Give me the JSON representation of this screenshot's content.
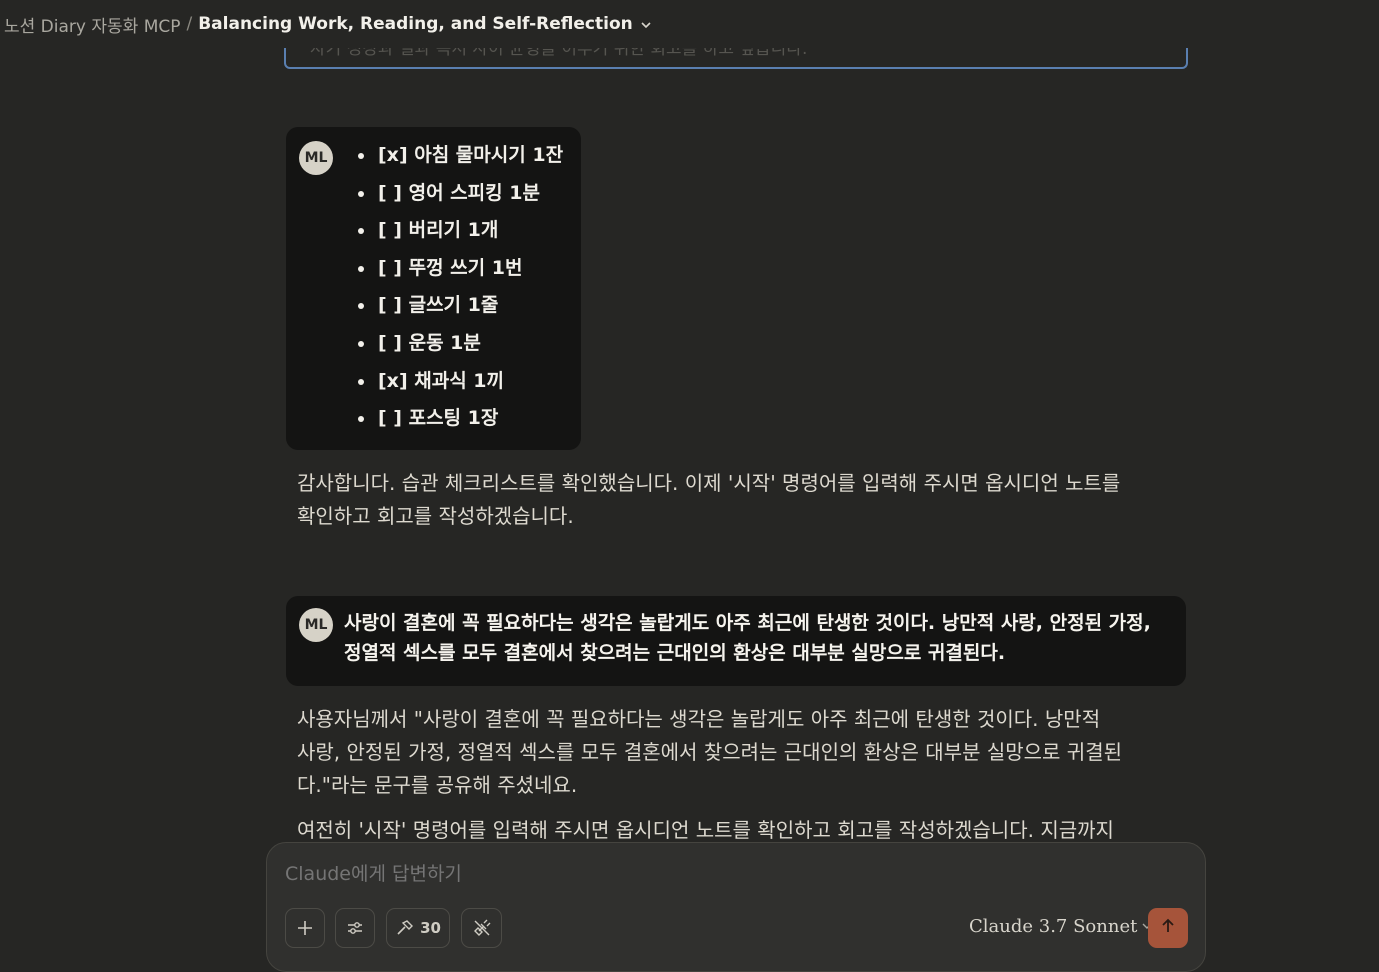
{
  "header": {
    "project": "노션 Diary 자동화 MCP",
    "separator": "/",
    "title": "Balancing Work, Reading, and Self-Reflection"
  },
  "previous_input_fragment": "자기 성장과 일과 독서 사이 균형을 이루기 위한 회고를 하고 싶습니다.",
  "messages": {
    "checklist_message": {
      "avatar": "ML",
      "items": [
        "[x] 아침 물마시기 1잔",
        "[ ] 영어 스피킹 1분",
        "[ ] 버리기 1개",
        "[ ] 뚜껑 쓰기 1번",
        "[ ] 글쓰기 1줄",
        "[ ] 운동 1분",
        "[x] 채과식 1끼",
        "[ ] 포스팅 1장"
      ]
    },
    "reply_1": {
      "line1": "감사합니다. 습관 체크리스트를 확인했습니다. 이제 '시작' 명령어를 입력해 주시면 옵시디언 노트를",
      "line2": "확인하고 회고를 작성하겠습니다."
    },
    "quote_message": {
      "avatar": "ML",
      "line1": "사랑이 결혼에 꼭 필요하다는 생각은 놀랍게도 아주 최근에 탄생한 것이다. 낭만적 사랑, 안정된 가정,",
      "line2": "정열적 섹스를 모두 결혼에서 찾으려는 근대인의 환상은 대부분 실망으로 귀결된다."
    },
    "reply_2": {
      "line1": "사용자님께서 \"사랑이 결혼에 꼭 필요하다는 생각은 놀랍게도 아주 최근에 탄생한 것이다. 낭만적",
      "line2": "사랑, 안정된 가정, 정열적 섹스를 모두 결혼에서 찾으려는 근대인의 환상은 대부분 실망으로 귀결된",
      "line3": "다.\"라는 문구를 공유해 주셨네요.",
      "line4": "여전히 '시작' 명령어를 입력해 주시면 옵시디언 노트를 확인하고 회고를 작성하겠습니다. 지금까지"
    }
  },
  "composer": {
    "placeholder": "Claude에게 답변하기",
    "tools_count": "30",
    "model": "Claude 3.7 Sonnet"
  },
  "colors": {
    "background": "#262624",
    "user_bubble": "#141413",
    "send_button": "#a6543a",
    "avatar_bg": "#d6d2c7"
  },
  "icons": [
    "chevron-down-icon",
    "plus-icon",
    "sliders-icon",
    "hammer-icon",
    "plug-off-icon",
    "arrow-up-icon"
  ]
}
